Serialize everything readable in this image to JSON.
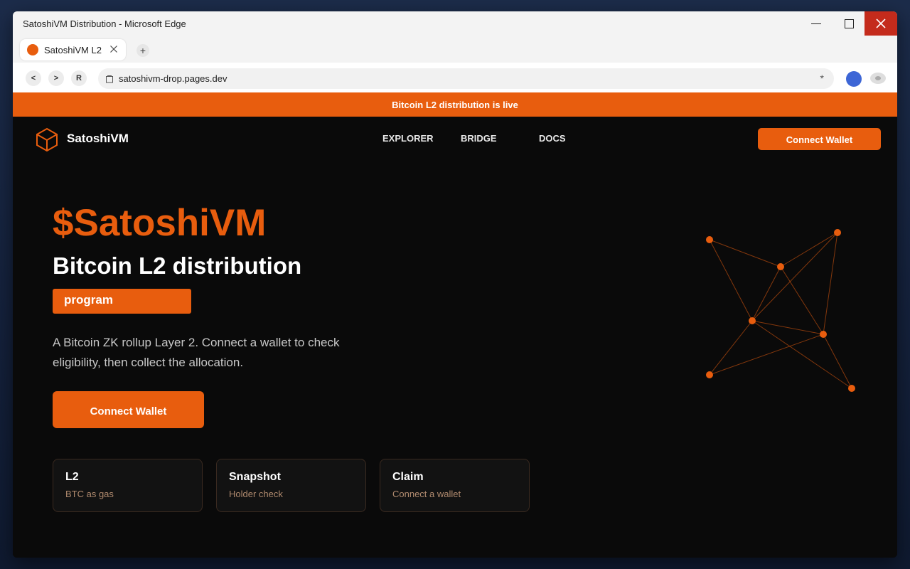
{
  "window": {
    "title": "SatoshiVM Distribution - Microsoft Edge"
  },
  "tab": {
    "label": "SatoshiVM L2",
    "new_tab_label": "+"
  },
  "toolbar": {
    "back_label": "<",
    "forward_label": ">",
    "reload_label": "R",
    "url": "satoshivm-drop.pages.dev",
    "star_label": "*"
  },
  "banner": {
    "text": "Bitcoin L2 distribution is live"
  },
  "header": {
    "brand": "SatoshiVM",
    "nav": [
      "EXPLORER",
      "BRIDGE",
      "DOCS"
    ],
    "connect_label": "Connect Wallet"
  },
  "hero": {
    "title": "$SatoshiVM",
    "subtitle": "Bitcoin L2 distribution",
    "pill": "program",
    "description": "A Bitcoin ZK rollup Layer 2. Connect a wallet to check eligibility, then collect the allocation.",
    "cta_label": "Connect Wallet"
  },
  "cards": [
    {
      "title": "L2",
      "subtitle": "BTC as gas"
    },
    {
      "title": "Snapshot",
      "subtitle": "Holder check"
    },
    {
      "title": "Claim",
      "subtitle": "Connect a wallet"
    }
  ],
  "colors": {
    "accent": "#e85d0e",
    "background": "#0a0a0a",
    "close_button": "#c42b1c",
    "profile": "#3d66d6"
  },
  "icons": {
    "logo": "cube-icon",
    "tab_favicon": "orange-dot-icon",
    "address_bar": "page-icon",
    "decoration": "network-graph-icon"
  }
}
